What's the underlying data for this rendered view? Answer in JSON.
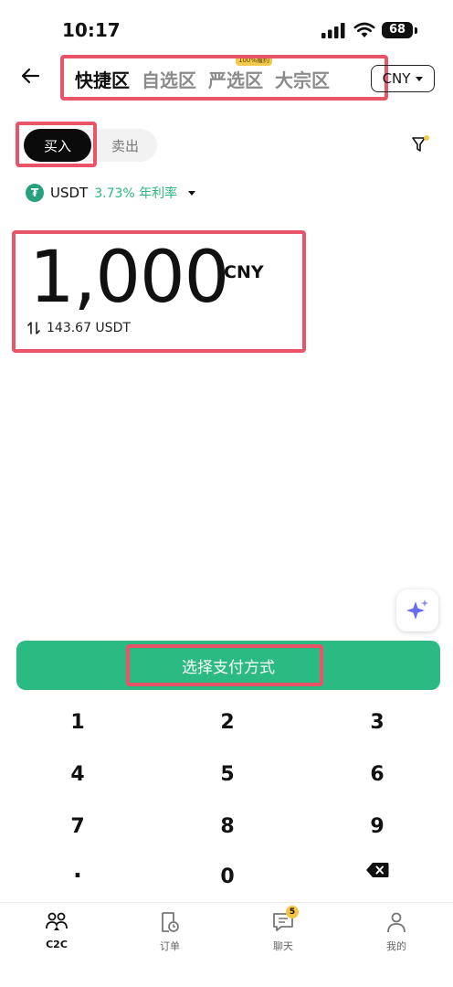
{
  "status": {
    "time": "10:17",
    "battery": "68"
  },
  "header": {
    "tabs": [
      {
        "label": "快捷区",
        "active": true
      },
      {
        "label": "自选区",
        "active": false
      },
      {
        "label": "严选区",
        "active": false,
        "badge": "100%履约"
      },
      {
        "label": "大宗区",
        "active": false
      }
    ],
    "currency": "CNY"
  },
  "trade": {
    "buy_label": "买入",
    "sell_label": "卖出"
  },
  "asset": {
    "icon_glyph": "₮",
    "name": "USDT",
    "rate": "3.73% 年利率"
  },
  "amount": {
    "value": "1,000",
    "unit": "CNY",
    "conversion": "143.67 USDT"
  },
  "pay_button": "选择支付方式",
  "keypad": [
    "1",
    "2",
    "3",
    "4",
    "5",
    "6",
    "7",
    "8",
    "9",
    ".",
    "0"
  ],
  "nav": {
    "items": [
      {
        "label": "C2C",
        "active": true
      },
      {
        "label": "订单",
        "active": false
      },
      {
        "label": "聊天",
        "active": false,
        "badge": "5"
      },
      {
        "label": "我的",
        "active": false
      }
    ]
  },
  "colors": {
    "accent": "#2bbb82",
    "highlight": "#ea5468",
    "rate": "#2bb77d"
  }
}
